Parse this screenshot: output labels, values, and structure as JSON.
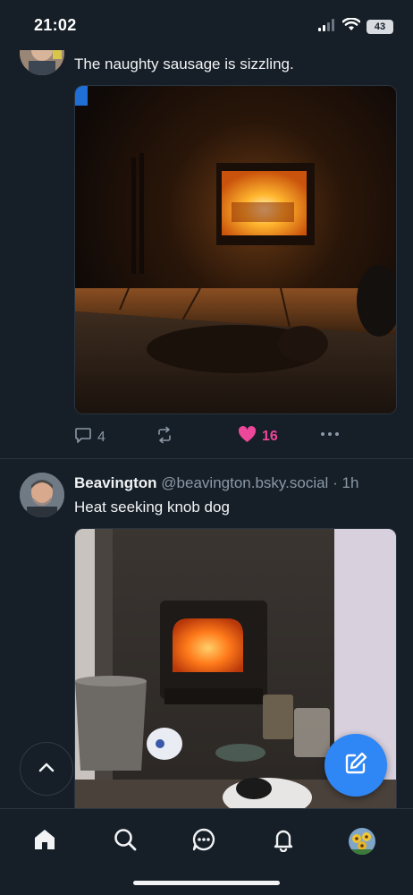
{
  "status_bar": {
    "time": "21:02",
    "battery": "43",
    "icons": [
      "cellular-signal-icon",
      "wifi-icon",
      "battery-icon"
    ]
  },
  "posts": [
    {
      "text": "The naughty sausage is sizzling.",
      "image_alt": "Dark room with a wood-burning stove fire and a dog lying on the rug in front of it",
      "actions": {
        "replies": "4",
        "reposts": "",
        "likes": "16",
        "liked": true
      }
    },
    {
      "author": "Beavington",
      "handle": "@beavington.bsky.social",
      "separator": "·",
      "time": "1h",
      "text": "Heat seeking knob dog",
      "image_alt": "Stone fireplace with a lit stove, a metal bucket, a teapot, a dog bowl and a sleeping dog"
    }
  ],
  "nav": {
    "items": [
      "home",
      "search",
      "chat",
      "notifications",
      "profile"
    ],
    "active": "home"
  },
  "colors": {
    "background": "#161e27",
    "accent": "#2f86f5",
    "like": "#ec4899",
    "muted": "#8b98a7"
  }
}
